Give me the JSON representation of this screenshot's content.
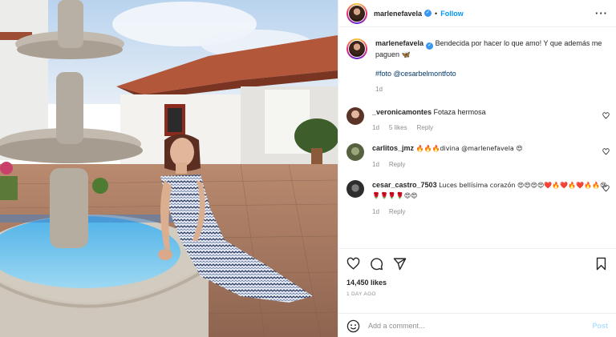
{
  "header": {
    "username": "marlenefavela",
    "separator": "•",
    "follow_label": "Follow",
    "more_label": "···"
  },
  "caption": {
    "username": "marlenefavela",
    "text": "Bendecida por hacer lo que amo! Y que además me paguen 🦋",
    "hashtags": "#foto @cesarbelmontfoto",
    "time": "1d"
  },
  "comments": [
    {
      "username": "_veronicamontes",
      "text": "Fotaza hermosa",
      "time": "1d",
      "likes": "5 likes",
      "reply": "Reply",
      "avatar_color": "#6b4a3a"
    },
    {
      "username": "carlitos_jmz",
      "text": "🔥🔥🔥divina @marlenefavela 😍",
      "time": "1d",
      "reply": "Reply",
      "avatar_color": "#6e7a5a"
    },
    {
      "username": "cesar_castro_7503",
      "text": "Luces bellísima corazón 😍😍😍😍❤️🔥❤️🔥❤️🔥🔥😍🌹🌹🌹🌹😍😍",
      "time": "1d",
      "reply": "Reply",
      "avatar_color": "#3a3a3a"
    }
  ],
  "actions": {
    "like_icon": "heart-icon",
    "comment_icon": "comment-icon",
    "share_icon": "share-icon",
    "save_icon": "bookmark-icon"
  },
  "likes": "14,450 likes",
  "posted_ago": "1 DAY AGO",
  "add_comment": {
    "placeholder": "Add a comment...",
    "post_label": "Post"
  },
  "colors": {
    "accent": "#0095f6",
    "post_disabled": "#b2dffc",
    "muted": "#8e8e8e",
    "verified": "#3897f0"
  }
}
